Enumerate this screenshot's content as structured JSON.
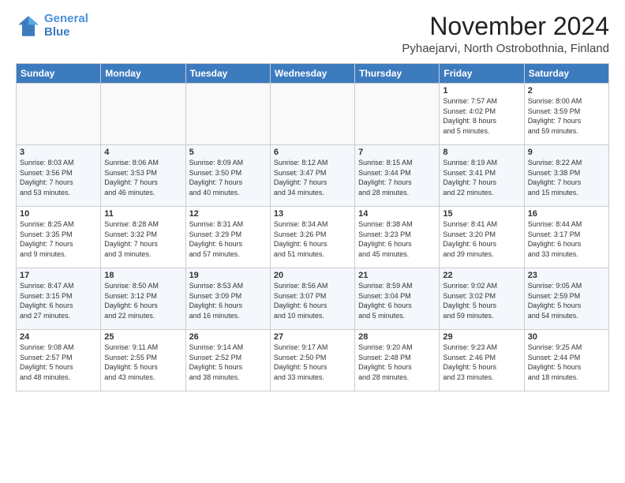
{
  "header": {
    "logo_line1": "General",
    "logo_line2": "Blue",
    "month_title": "November 2024",
    "location": "Pyhaejarvi, North Ostrobothnia, Finland"
  },
  "weekdays": [
    "Sunday",
    "Monday",
    "Tuesday",
    "Wednesday",
    "Thursday",
    "Friday",
    "Saturday"
  ],
  "weeks": [
    [
      {
        "day": "",
        "info": ""
      },
      {
        "day": "",
        "info": ""
      },
      {
        "day": "",
        "info": ""
      },
      {
        "day": "",
        "info": ""
      },
      {
        "day": "",
        "info": ""
      },
      {
        "day": "1",
        "info": "Sunrise: 7:57 AM\nSunset: 4:02 PM\nDaylight: 8 hours\nand 5 minutes."
      },
      {
        "day": "2",
        "info": "Sunrise: 8:00 AM\nSunset: 3:59 PM\nDaylight: 7 hours\nand 59 minutes."
      }
    ],
    [
      {
        "day": "3",
        "info": "Sunrise: 8:03 AM\nSunset: 3:56 PM\nDaylight: 7 hours\nand 53 minutes."
      },
      {
        "day": "4",
        "info": "Sunrise: 8:06 AM\nSunset: 3:53 PM\nDaylight: 7 hours\nand 46 minutes."
      },
      {
        "day": "5",
        "info": "Sunrise: 8:09 AM\nSunset: 3:50 PM\nDaylight: 7 hours\nand 40 minutes."
      },
      {
        "day": "6",
        "info": "Sunrise: 8:12 AM\nSunset: 3:47 PM\nDaylight: 7 hours\nand 34 minutes."
      },
      {
        "day": "7",
        "info": "Sunrise: 8:15 AM\nSunset: 3:44 PM\nDaylight: 7 hours\nand 28 minutes."
      },
      {
        "day": "8",
        "info": "Sunrise: 8:19 AM\nSunset: 3:41 PM\nDaylight: 7 hours\nand 22 minutes."
      },
      {
        "day": "9",
        "info": "Sunrise: 8:22 AM\nSunset: 3:38 PM\nDaylight: 7 hours\nand 15 minutes."
      }
    ],
    [
      {
        "day": "10",
        "info": "Sunrise: 8:25 AM\nSunset: 3:35 PM\nDaylight: 7 hours\nand 9 minutes."
      },
      {
        "day": "11",
        "info": "Sunrise: 8:28 AM\nSunset: 3:32 PM\nDaylight: 7 hours\nand 3 minutes."
      },
      {
        "day": "12",
        "info": "Sunrise: 8:31 AM\nSunset: 3:29 PM\nDaylight: 6 hours\nand 57 minutes."
      },
      {
        "day": "13",
        "info": "Sunrise: 8:34 AM\nSunset: 3:26 PM\nDaylight: 6 hours\nand 51 minutes."
      },
      {
        "day": "14",
        "info": "Sunrise: 8:38 AM\nSunset: 3:23 PM\nDaylight: 6 hours\nand 45 minutes."
      },
      {
        "day": "15",
        "info": "Sunrise: 8:41 AM\nSunset: 3:20 PM\nDaylight: 6 hours\nand 39 minutes."
      },
      {
        "day": "16",
        "info": "Sunrise: 8:44 AM\nSunset: 3:17 PM\nDaylight: 6 hours\nand 33 minutes."
      }
    ],
    [
      {
        "day": "17",
        "info": "Sunrise: 8:47 AM\nSunset: 3:15 PM\nDaylight: 6 hours\nand 27 minutes."
      },
      {
        "day": "18",
        "info": "Sunrise: 8:50 AM\nSunset: 3:12 PM\nDaylight: 6 hours\nand 22 minutes."
      },
      {
        "day": "19",
        "info": "Sunrise: 8:53 AM\nSunset: 3:09 PM\nDaylight: 6 hours\nand 16 minutes."
      },
      {
        "day": "20",
        "info": "Sunrise: 8:56 AM\nSunset: 3:07 PM\nDaylight: 6 hours\nand 10 minutes."
      },
      {
        "day": "21",
        "info": "Sunrise: 8:59 AM\nSunset: 3:04 PM\nDaylight: 6 hours\nand 5 minutes."
      },
      {
        "day": "22",
        "info": "Sunrise: 9:02 AM\nSunset: 3:02 PM\nDaylight: 5 hours\nand 59 minutes."
      },
      {
        "day": "23",
        "info": "Sunrise: 9:05 AM\nSunset: 2:59 PM\nDaylight: 5 hours\nand 54 minutes."
      }
    ],
    [
      {
        "day": "24",
        "info": "Sunrise: 9:08 AM\nSunset: 2:57 PM\nDaylight: 5 hours\nand 48 minutes."
      },
      {
        "day": "25",
        "info": "Sunrise: 9:11 AM\nSunset: 2:55 PM\nDaylight: 5 hours\nand 43 minutes."
      },
      {
        "day": "26",
        "info": "Sunrise: 9:14 AM\nSunset: 2:52 PM\nDaylight: 5 hours\nand 38 minutes."
      },
      {
        "day": "27",
        "info": "Sunrise: 9:17 AM\nSunset: 2:50 PM\nDaylight: 5 hours\nand 33 minutes."
      },
      {
        "day": "28",
        "info": "Sunrise: 9:20 AM\nSunset: 2:48 PM\nDaylight: 5 hours\nand 28 minutes."
      },
      {
        "day": "29",
        "info": "Sunrise: 9:23 AM\nSunset: 2:46 PM\nDaylight: 5 hours\nand 23 minutes."
      },
      {
        "day": "30",
        "info": "Sunrise: 9:25 AM\nSunset: 2:44 PM\nDaylight: 5 hours\nand 18 minutes."
      }
    ]
  ]
}
